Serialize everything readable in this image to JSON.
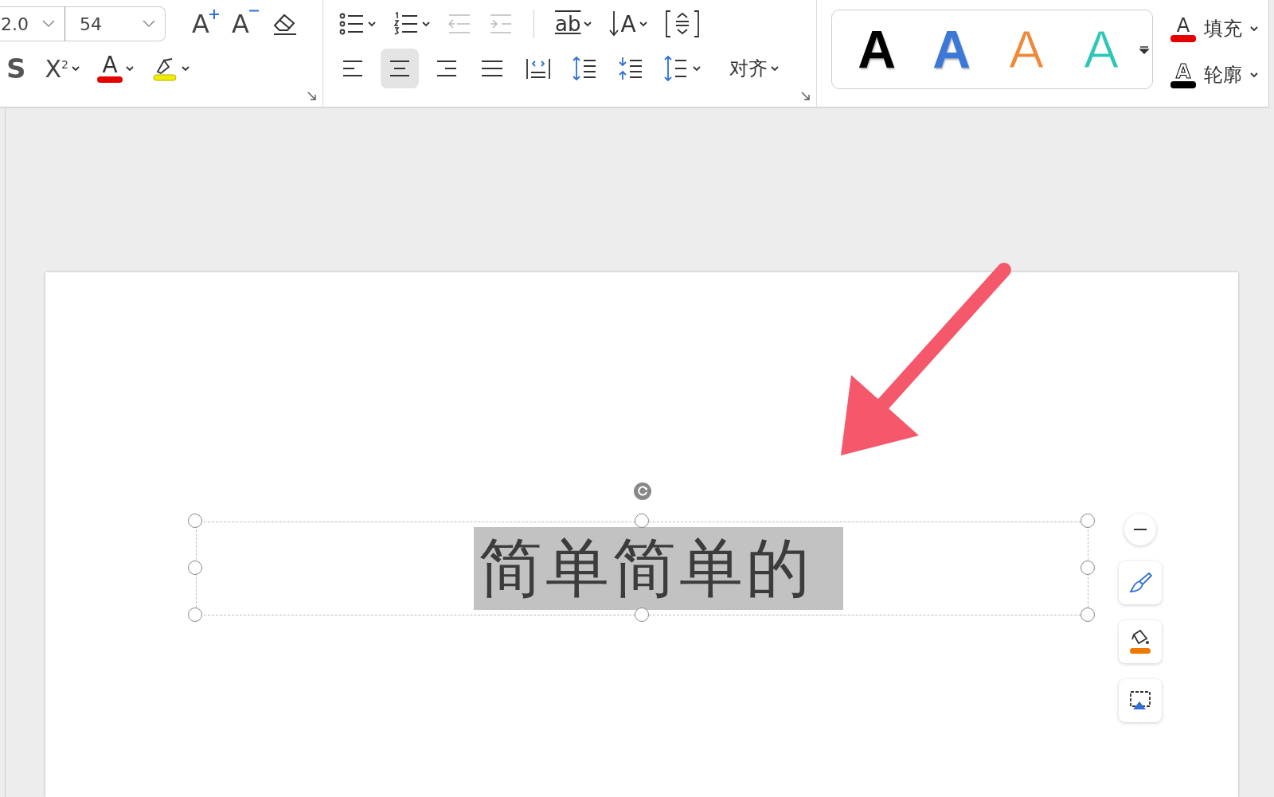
{
  "font_group": {
    "font_field": {
      "value": "2.0"
    },
    "size_field": {
      "value": "54"
    },
    "row1_tools": [
      {
        "kind": "grow",
        "glyph": "A"
      },
      {
        "kind": "shrink",
        "glyph": "A"
      },
      {
        "kind": "clear"
      }
    ],
    "row2_tools": [
      {
        "kind": "strike",
        "glyph": "S"
      },
      {
        "kind": "superscript",
        "glyph": "X$^{2}$"
      },
      {
        "kind": "font_color",
        "glyph": "A"
      },
      {
        "kind": "highlight"
      }
    ]
  },
  "paragraph_group": {
    "list_tools": [
      {
        "kind": "bullets",
        "disabled": false
      },
      {
        "kind": "numbering",
        "disabled": false
      },
      {
        "kind": "outdent",
        "disabled": true
      },
      {
        "kind": "indent",
        "disabled": true
      }
    ],
    "text_tools": [
      {
        "kind": "direction",
        "glyph": "ab"
      },
      {
        "kind": "sort",
        "glyph": "A"
      },
      {
        "kind": "frame"
      }
    ],
    "align_buttons": [
      {
        "kind": "left",
        "selected": false
      },
      {
        "kind": "center",
        "selected": true
      },
      {
        "kind": "right",
        "selected": false
      },
      {
        "kind": "justify",
        "selected": false
      },
      {
        "kind": "distribute",
        "selected": false
      }
    ],
    "spacing_tools": [
      {
        "kind": "before"
      },
      {
        "kind": "after"
      },
      {
        "kind": "line"
      }
    ],
    "align_menu": {
      "label": "对齐"
    }
  },
  "wordart_gallery": {
    "styles": [
      {
        "kind": "solid",
        "glyph": "A",
        "color": "#000000"
      },
      {
        "kind": "solid",
        "glyph": "A",
        "color": "#3b78d8"
      },
      {
        "kind": "outline",
        "glyph": "A",
        "color": "#f0883a"
      },
      {
        "kind": "outline",
        "glyph": "A",
        "color": "#2ec6b8"
      }
    ]
  },
  "text_fill": {
    "label": "填充",
    "glyph": "A",
    "color": "#e60000"
  },
  "text_outline": {
    "label": "轮廓",
    "glyph": "A",
    "color": "#000000"
  },
  "slide": {
    "text_box": {
      "text": "简单简单的",
      "text_selected": true
    }
  },
  "float_tools": [
    {
      "kind": "collapse"
    },
    {
      "kind": "brush"
    },
    {
      "kind": "fill"
    },
    {
      "kind": "frame"
    }
  ]
}
